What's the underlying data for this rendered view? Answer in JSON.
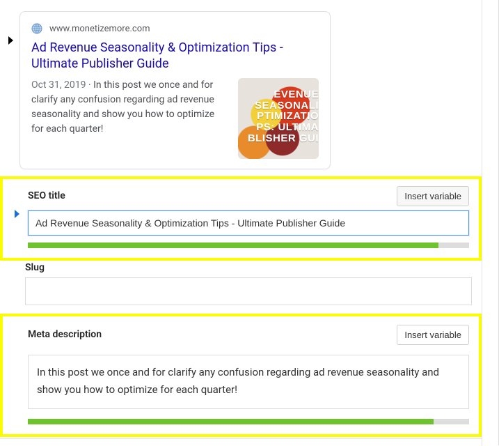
{
  "preview": {
    "domain": "www.monetizemore.com",
    "title": "Ad Revenue Seasonality & Optimization Tips - Ultimate Publisher Guide",
    "date": "Oct 31, 2019",
    "snippet_sep": " · ",
    "snippet": "In this post we once and for clarify any confusion regarding ad revenue seasonality and show you how to optimize for each quarter!",
    "thumb_lines": {
      "l1": "EVENUE SEASONALI",
      "l2": "PTIMIZATIO",
      "l3": "PS: ULTIMA",
      "l4": "BLISHER GUI"
    }
  },
  "seo_title": {
    "label": "SEO title",
    "insert_btn": "Insert variable",
    "value": "Ad Revenue Seasonality & Optimization Tips - Ultimate Publisher Guide",
    "progress_pct": 93
  },
  "slug": {
    "label": "Slug",
    "value": ""
  },
  "meta_description": {
    "label": "Meta description",
    "insert_btn": "Insert variable",
    "value": "In this post we once and for clarify any confusion regarding ad revenue seasonality and show you how to optimize for each quarter!",
    "progress_pct": 92
  }
}
